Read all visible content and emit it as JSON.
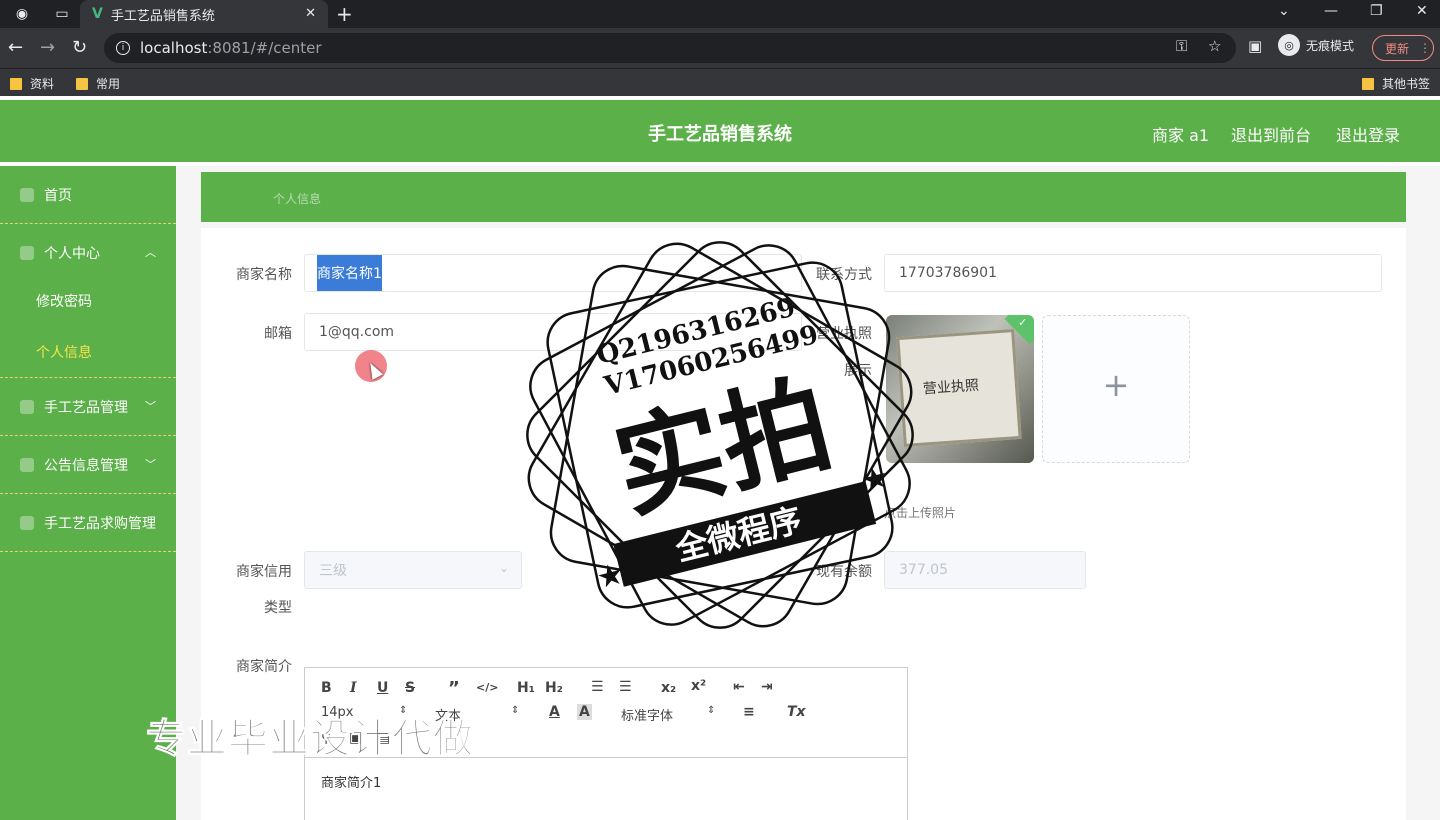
{
  "browser": {
    "tab_title": "手工艺品销售系统",
    "url_host": "localhost",
    "url_rest": ":8081/#/center",
    "incognito_label": "无痕模式",
    "update_label": "更新",
    "bookmarks": [
      "资料",
      "常用"
    ],
    "other_bookmarks": "其他书签"
  },
  "header": {
    "title": "手工艺品销售系统",
    "user": "商家 a1",
    "back_front": "退出到前台",
    "logout": "退出登录"
  },
  "sidebar": {
    "home": "首页",
    "personal_center": "个人中心",
    "change_password": "修改密码",
    "personal_info": "个人信息",
    "craft_mgmt": "手工艺品管理",
    "notice_mgmt": "公告信息管理",
    "purchase_mgmt": "手工艺品求购管理"
  },
  "breadcrumb": "个人信息",
  "form": {
    "merchant_name_label": "商家名称",
    "merchant_name": "商家名称1",
    "contact_label": "联系方式",
    "contact": "17703786901",
    "email_label": "邮箱",
    "email": "1@qq.com",
    "license_label_1": "营业执照",
    "license_label_2": "展示",
    "license_image_text": "营业执照",
    "upload_hint": "点击上传照片",
    "credit_label_1": "商家信用",
    "credit_label_2": "类型",
    "credit_value": "三级",
    "balance_label": "现有余额",
    "balance_value": "377.05",
    "intro_label": "商家简介",
    "intro_content": "商家简介1"
  },
  "editor_toolbar": {
    "size": "14px",
    "text": "文本",
    "font": "标准字体"
  },
  "watermark": {
    "qq": "Q2196316269",
    "vx": "V17060256499",
    "big": "实拍",
    "ribbon": "全微程序",
    "footer": "专业毕业设计代做"
  }
}
